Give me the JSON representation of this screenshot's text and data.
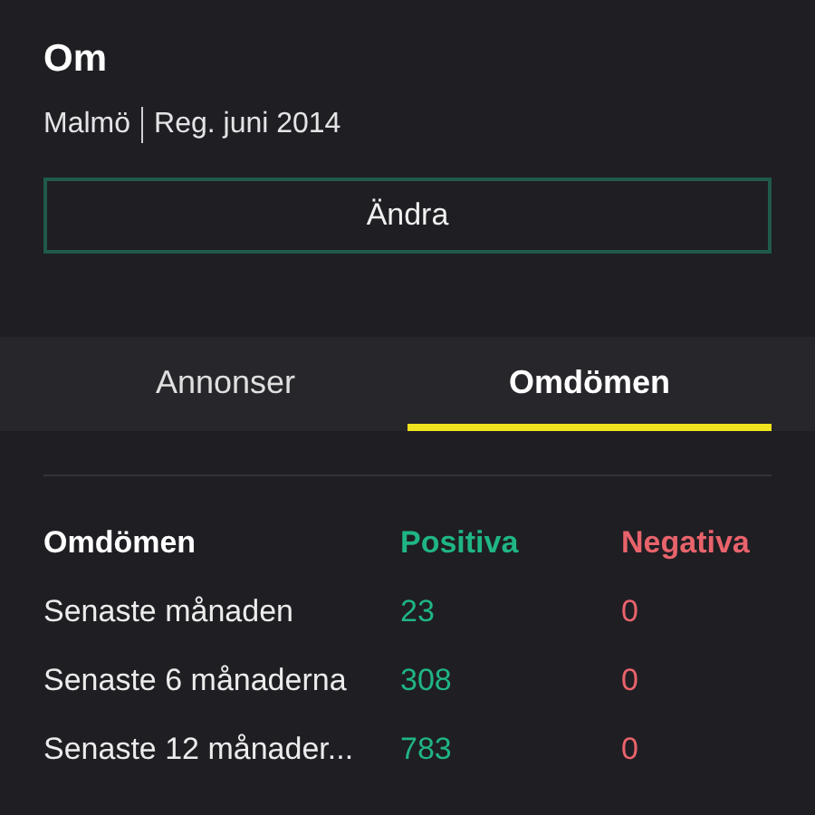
{
  "about": {
    "title": "Om",
    "location": "Malmö",
    "registered": "Reg. juni 2014",
    "edit_button": "Ändra"
  },
  "tabs": [
    {
      "label": "Annonser",
      "selected": false
    },
    {
      "label": "Omdömen",
      "selected": true
    }
  ],
  "reviews": {
    "columns": [
      "Omdömen",
      "Positiva",
      "Negativa"
    ],
    "rows": [
      {
        "period": "Senaste månaden",
        "positive": "23",
        "negative": "0"
      },
      {
        "period": "Senaste 6 månaderna",
        "positive": "308",
        "negative": "0"
      },
      {
        "period": "Senaste 12 månader...",
        "positive": "783",
        "negative": "0"
      }
    ]
  }
}
